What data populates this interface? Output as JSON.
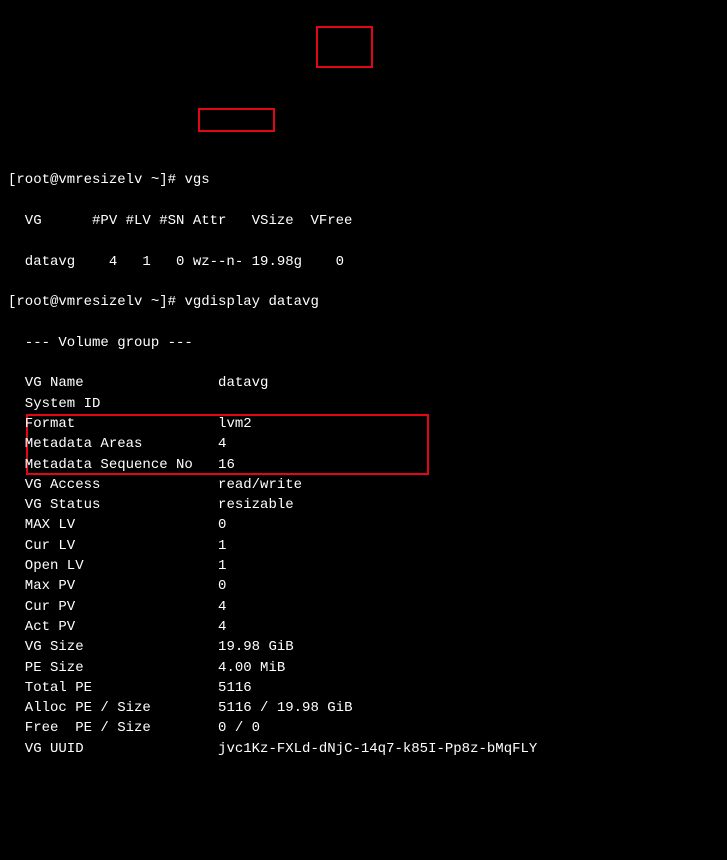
{
  "prompt1": "[root@vmresizelv ~]# ",
  "cmd1": "vgs",
  "vgs_header": "  VG      #PV #LV #SN Attr   VSize  VFree",
  "vgs_row": "  datavg    4   1   0 wz--n- 19.98g    0",
  "prompt2": "[root@vmresizelv ~]# ",
  "cmd2": "vgdisplay datavg",
  "vgd_header": "  --- Volume group ---",
  "rows": [
    {
      "label": "  VG Name",
      "value": "datavg"
    },
    {
      "label": "  System ID",
      "value": ""
    },
    {
      "label": "  Format",
      "value": "lvm2"
    },
    {
      "label": "  Metadata Areas",
      "value": "4"
    },
    {
      "label": "  Metadata Sequence No",
      "value": "16"
    },
    {
      "label": "  VG Access",
      "value": "read/write"
    },
    {
      "label": "  VG Status",
      "value": "resizable"
    },
    {
      "label": "  MAX LV",
      "value": "0"
    },
    {
      "label": "  Cur LV",
      "value": "1"
    },
    {
      "label": "  Open LV",
      "value": "1"
    },
    {
      "label": "  Max PV",
      "value": "0"
    },
    {
      "label": "  Cur PV",
      "value": "4"
    },
    {
      "label": "  Act PV",
      "value": "4"
    },
    {
      "label": "  VG Size",
      "value": "19.98 GiB"
    },
    {
      "label": "  PE Size",
      "value": "4.00 MiB"
    },
    {
      "label": "  Total PE",
      "value": "5116"
    },
    {
      "label": "  Alloc PE / Size",
      "value": "5116 / 19.98 GiB"
    },
    {
      "label": "  Free  PE / Size",
      "value": "0 / 0"
    },
    {
      "label": "  VG UUID",
      "value": "jvc1Kz-FXLd-dNjC-14q7-k85I-Pp8z-bMqFLY"
    }
  ]
}
